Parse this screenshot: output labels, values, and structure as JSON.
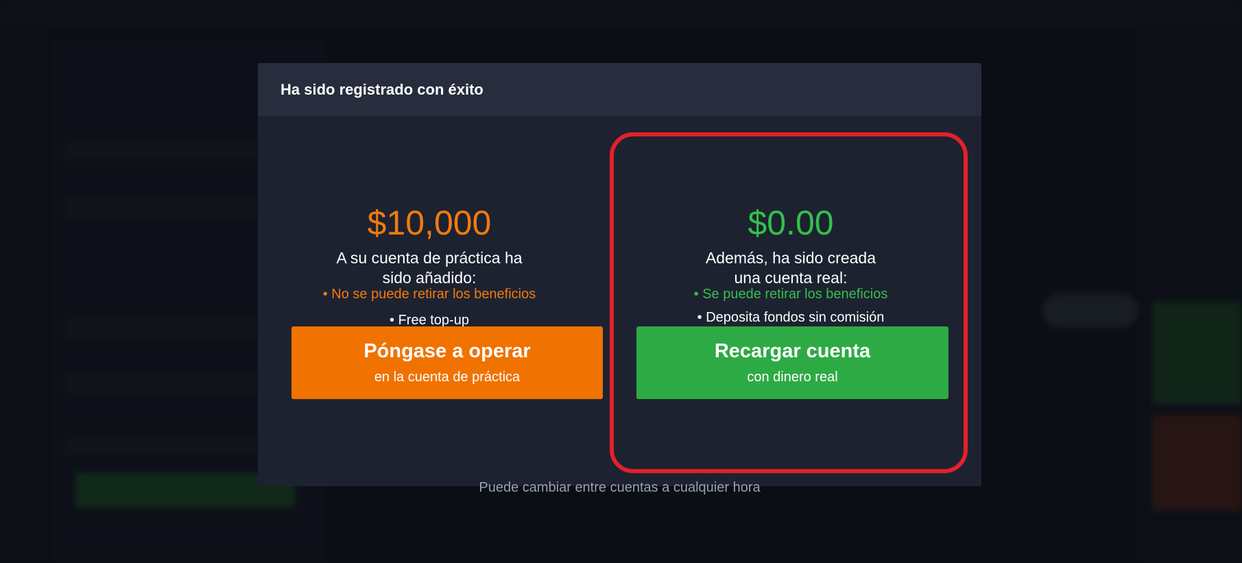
{
  "modal": {
    "title": "Ha sido registrado con éxito",
    "practice": {
      "heading_line1": "A su cuenta de práctica ha",
      "heading_line2": "sido añadido:",
      "amount": "$10,000",
      "bullet1": "• No se puede retirar los beneficios",
      "bullet2": "• Free top-up",
      "button_main": "Póngase a operar",
      "button_sub": "en la cuenta de práctica"
    },
    "real": {
      "heading_line1": "Además, ha sido creada",
      "heading_line2": "una cuenta real:",
      "amount": "$0.00",
      "bullet1": "• Se puede retirar los beneficios",
      "bullet2": "• Deposita fondos sin comisión",
      "button_main": "Recargar cuenta",
      "button_sub": "con dinero real"
    },
    "footer_note": "Puede cambiar entre cuentas a cualquier hora"
  },
  "colors": {
    "accent_orange": "#f07201",
    "accent_green": "#2eaa44",
    "highlight_red": "#e4202a"
  }
}
